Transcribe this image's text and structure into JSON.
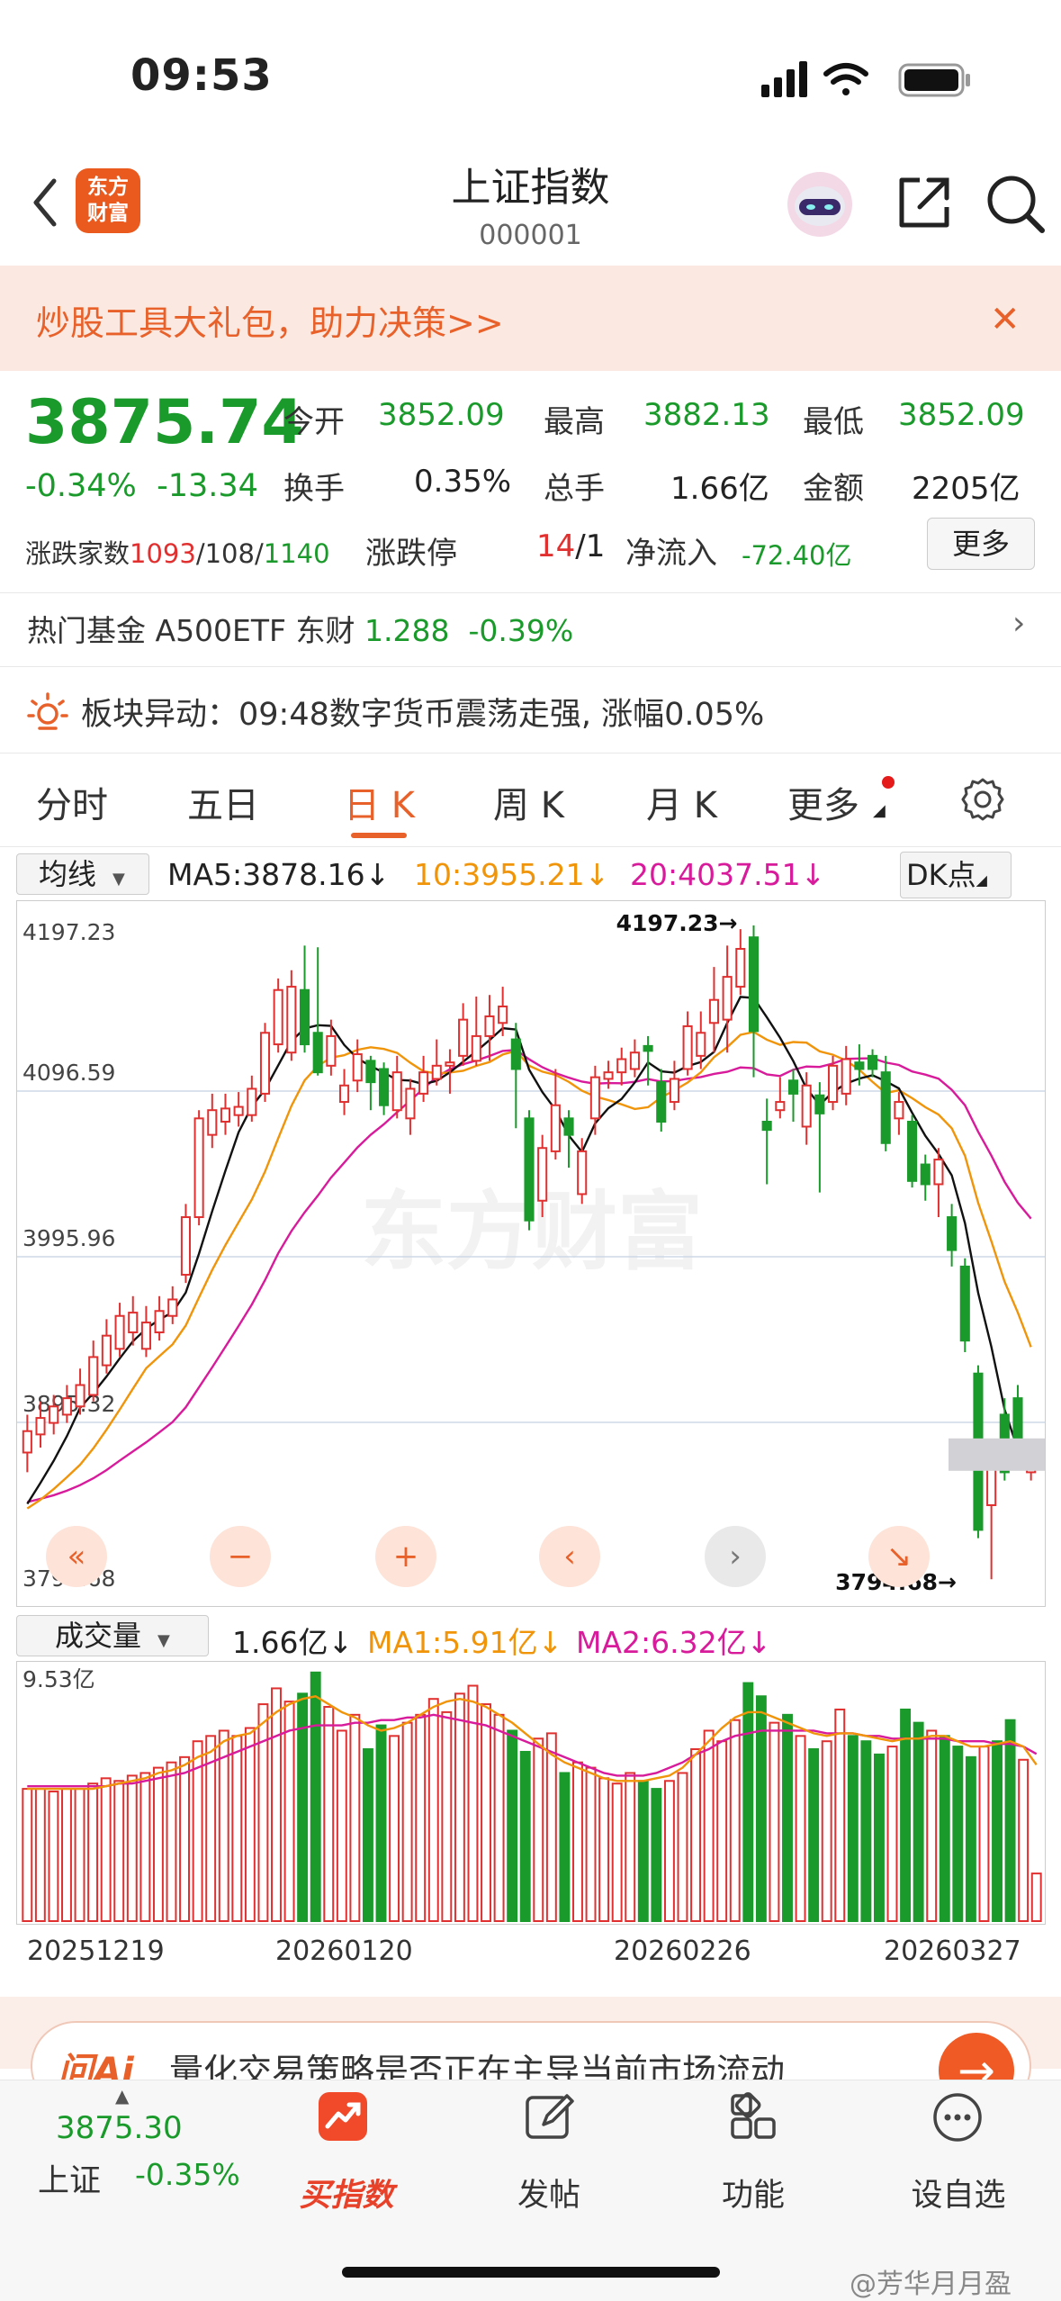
{
  "status": {
    "time": "09:53"
  },
  "header": {
    "logo": "东方财富",
    "logo_line1": "东方",
    "logo_line2": "财富",
    "title": "上证指数",
    "code": "000001"
  },
  "banner": {
    "text": "炒股工具大礼包，助力决策>>"
  },
  "quote": {
    "price": "3875.74",
    "pct": "-0.34%",
    "change": "-13.34",
    "open_label": "今开",
    "open": "3852.09",
    "high_label": "最高",
    "high": "3882.13",
    "low_label": "最低",
    "low": "3852.09",
    "turnover_label": "换手",
    "turnover": "0.35%",
    "vol_label": "总手",
    "vol": "1.66亿",
    "amount_label": "金额",
    "amount": "2205亿",
    "breadth_label": "涨跌家数",
    "up": "1093",
    "flat": "/108/",
    "down": "1140",
    "limit_label": "涨跌停",
    "limit_up": "14",
    "limit_down": "/1",
    "inflow_label": "净流入",
    "inflow": "-72.40亿",
    "more": "更多"
  },
  "fund": {
    "text": "热门基金 A500ETF 东财 ",
    "price": "1.288",
    "pct": "-0.39%"
  },
  "sector": {
    "text": "板块异动：09:48数字货币震荡走强, 涨幅0.05%"
  },
  "tabs": [
    "分时",
    "五日",
    "日 K",
    "周 K",
    "月 K",
    "更多"
  ],
  "active_tab": "日 K",
  "ma": {
    "select": "均线",
    "ma5": "MA5:3878.16",
    "ma10": "10:3955.21",
    "ma20": "20:4037.51",
    "dk": "DK点"
  },
  "vol": {
    "select": "成交量",
    "v": "1.66亿",
    "ma1": "MA1:5.91亿",
    "ma2": "MA2:6.32亿"
  },
  "colors": {
    "up": "#e03030",
    "down": "#1a9a2a",
    "ma5": "#111111",
    "ma10": "#f0940a",
    "ma20": "#d81b9b",
    "accent": "#e8612a"
  },
  "chart_data": [
    {
      "type": "candlestick",
      "title": "",
      "y_ticks": [
        "4197.23",
        "4096.59",
        "3995.96",
        "3895.32",
        "3794.68"
      ],
      "ylim": [
        3794.68,
        4197.23
      ],
      "annotations": [
        {
          "text": "4197.23",
          "value": 4197.23
        },
        {
          "text": "3794.68",
          "value": 3794.68
        }
      ],
      "x_ticks": [
        "20251219",
        "20260120",
        "20260226",
        "20260327"
      ],
      "candles": [
        {
          "o": 3877,
          "c": 3890,
          "h": 3900,
          "l": 3865
        },
        {
          "o": 3888,
          "c": 3898,
          "h": 3908,
          "l": 3880
        },
        {
          "o": 3895,
          "c": 3905,
          "h": 3912,
          "l": 3888
        },
        {
          "o": 3900,
          "c": 3910,
          "h": 3918,
          "l": 3895
        },
        {
          "o": 3905,
          "c": 3918,
          "h": 3928,
          "l": 3900
        },
        {
          "o": 3912,
          "c": 3935,
          "h": 3945,
          "l": 3908
        },
        {
          "o": 3930,
          "c": 3948,
          "h": 3958,
          "l": 3925
        },
        {
          "o": 3940,
          "c": 3960,
          "h": 3968,
          "l": 3935
        },
        {
          "o": 3950,
          "c": 3962,
          "h": 3972,
          "l": 3942
        },
        {
          "o": 3940,
          "c": 3956,
          "h": 3966,
          "l": 3935
        },
        {
          "o": 3950,
          "c": 3963,
          "h": 3972,
          "l": 3945
        },
        {
          "o": 3960,
          "c": 3970,
          "h": 3978,
          "l": 3955
        },
        {
          "o": 3985,
          "c": 4020,
          "h": 4028,
          "l": 3980
        },
        {
          "o": 4020,
          "c": 4080,
          "h": 4085,
          "l": 4015
        },
        {
          "o": 4070,
          "c": 4085,
          "h": 4095,
          "l": 4062
        },
        {
          "o": 4078,
          "c": 4086,
          "h": 4095,
          "l": 4070
        },
        {
          "o": 4082,
          "c": 4087,
          "h": 4096,
          "l": 4075
        },
        {
          "o": 4082,
          "c": 4098,
          "h": 4106,
          "l": 4078
        },
        {
          "o": 4095,
          "c": 4132,
          "h": 4138,
          "l": 4090
        },
        {
          "o": 4125,
          "c": 4158,
          "h": 4165,
          "l": 4120
        },
        {
          "o": 4120,
          "c": 4160,
          "h": 4170,
          "l": 4115
        },
        {
          "o": 4158,
          "c": 4125,
          "h": 4185,
          "l": 4120
        },
        {
          "o": 4132,
          "c": 4108,
          "h": 4184,
          "l": 4106
        },
        {
          "o": 4112,
          "c": 4130,
          "h": 4140,
          "l": 4106
        },
        {
          "o": 4090,
          "c": 4100,
          "h": 4110,
          "l": 4082
        },
        {
          "o": 4103,
          "c": 4119,
          "h": 4128,
          "l": 4096
        },
        {
          "o": 4115,
          "c": 4102,
          "h": 4118,
          "l": 4085
        },
        {
          "o": 4110,
          "c": 4088,
          "h": 4114,
          "l": 4082
        },
        {
          "o": 4085,
          "c": 4108,
          "h": 4118,
          "l": 4080
        },
        {
          "o": 4080,
          "c": 4098,
          "h": 4104,
          "l": 4070
        },
        {
          "o": 4095,
          "c": 4108,
          "h": 4118,
          "l": 4090
        },
        {
          "o": 4104,
          "c": 4112,
          "h": 4128,
          "l": 4100
        },
        {
          "o": 4112,
          "c": 4114,
          "h": 4122,
          "l": 4095
        },
        {
          "o": 4118,
          "c": 4140,
          "h": 4150,
          "l": 4112
        },
        {
          "o": 4115,
          "c": 4130,
          "h": 4154,
          "l": 4112
        },
        {
          "o": 4130,
          "c": 4142,
          "h": 4155,
          "l": 4115
        },
        {
          "o": 4138,
          "c": 4148,
          "h": 4160,
          "l": 4130
        },
        {
          "o": 4128,
          "c": 4110,
          "h": 4138,
          "l": 4074
        },
        {
          "o": 4080,
          "c": 4018,
          "h": 4085,
          "l": 4012
        },
        {
          "o": 4030,
          "c": 4062,
          "h": 4070,
          "l": 4020
        },
        {
          "o": 4060,
          "c": 4088,
          "h": 4110,
          "l": 4055
        },
        {
          "o": 4080,
          "c": 4070,
          "h": 4085,
          "l": 4050
        },
        {
          "o": 4034,
          "c": 4060,
          "h": 4068,
          "l": 4028
        },
        {
          "o": 4080,
          "c": 4105,
          "h": 4112,
          "l": 4070
        },
        {
          "o": 4104,
          "c": 4108,
          "h": 4115,
          "l": 4098
        },
        {
          "o": 4108,
          "c": 4116,
          "h": 4123,
          "l": 4100
        },
        {
          "o": 4110,
          "c": 4120,
          "h": 4128,
          "l": 4105
        },
        {
          "o": 4124,
          "c": 4121,
          "h": 4130,
          "l": 4100
        },
        {
          "o": 4102,
          "c": 4078,
          "h": 4110,
          "l": 4072
        },
        {
          "o": 4090,
          "c": 4104,
          "h": 4115,
          "l": 4085
        },
        {
          "o": 4110,
          "c": 4136,
          "h": 4145,
          "l": 4106
        },
        {
          "o": 4118,
          "c": 4132,
          "h": 4145,
          "l": 4110
        },
        {
          "o": 4138,
          "c": 4152,
          "h": 4172,
          "l": 4120
        },
        {
          "o": 4140,
          "c": 4166,
          "h": 4185,
          "l": 4120
        },
        {
          "o": 4160,
          "c": 4183,
          "h": 4195,
          "l": 4155
        },
        {
          "o": 4190,
          "c": 4133,
          "h": 4197.23,
          "l": 4105
        },
        {
          "o": 4078,
          "c": 4073,
          "h": 4092,
          "l": 4040
        },
        {
          "o": 4085,
          "c": 4090,
          "h": 4105,
          "l": 4080
        },
        {
          "o": 4103,
          "c": 4095,
          "h": 4110,
          "l": 4078
        },
        {
          "o": 4075,
          "c": 4100,
          "h": 4108,
          "l": 4064
        },
        {
          "o": 4094,
          "c": 4083,
          "h": 4102,
          "l": 4035
        },
        {
          "o": 4090,
          "c": 4112,
          "h": 4118,
          "l": 4085
        },
        {
          "o": 4095,
          "c": 4116,
          "h": 4124,
          "l": 4088
        },
        {
          "o": 4114,
          "c": 4110,
          "h": 4125,
          "l": 4100
        },
        {
          "o": 4118,
          "c": 4110,
          "h": 4122,
          "l": 4105
        },
        {
          "o": 4108,
          "c": 4065,
          "h": 4118,
          "l": 4060
        },
        {
          "o": 4080,
          "c": 4090,
          "h": 4096,
          "l": 4070
        },
        {
          "o": 4078,
          "c": 4042,
          "h": 4082,
          "l": 4038
        },
        {
          "o": 4052,
          "c": 4040,
          "h": 4058,
          "l": 4030
        },
        {
          "o": 4040,
          "c": 4055,
          "h": 4062,
          "l": 4020
        },
        {
          "o": 4020,
          "c": 4000,
          "h": 4028,
          "l": 3990
        },
        {
          "o": 3990,
          "c": 3945,
          "h": 3995,
          "l": 3938
        },
        {
          "o": 3925,
          "c": 3830,
          "h": 3930,
          "l": 3825
        },
        {
          "o": 3845,
          "c": 3876,
          "h": 3885,
          "l": 3800
        },
        {
          "o": 3900,
          "c": 3865,
          "h": 3910,
          "l": 3860
        },
        {
          "o": 3910,
          "c": 3878,
          "h": 3918,
          "l": 3875
        },
        {
          "o": 3865,
          "c": 3880,
          "h": 3883,
          "l": 3860
        }
      ]
    },
    {
      "type": "bar",
      "title": "成交量",
      "y_ticks": [
        "9.53亿"
      ],
      "ylim": [
        0,
        9.53
      ],
      "volumes": [
        5.0,
        5.0,
        4.9,
        5.0,
        5.0,
        5.2,
        5.4,
        5.3,
        5.5,
        5.6,
        5.8,
        6.0,
        6.2,
        6.8,
        7.0,
        7.2,
        7.0,
        7.3,
        8.2,
        8.8,
        8.3,
        8.6,
        9.4,
        8.1,
        7.2,
        7.8,
        6.5,
        7.4,
        7.0,
        7.5,
        7.8,
        8.4,
        7.9,
        8.6,
        8.9,
        8.2,
        7.8,
        7.2,
        6.4,
        6.9,
        7.1,
        5.6,
        6.0,
        5.8,
        5.4,
        5.2,
        5.6,
        5.3,
        5.0,
        5.3,
        5.6,
        6.5,
        7.2,
        6.8,
        7.6,
        9.0,
        8.5,
        7.5,
        7.8,
        7.0,
        6.5,
        6.8,
        8.0,
        7.0,
        6.8,
        6.3,
        6.6,
        8.0,
        7.5,
        7.2,
        7.0,
        6.6,
        6.2,
        6.6,
        6.8,
        7.6,
        6.1,
        1.8
      ],
      "ma1": [
        5.0,
        5.0,
        5.0,
        5.0,
        5.0,
        5.0,
        5.1,
        5.2,
        5.3,
        5.4,
        5.6,
        5.7,
        5.9,
        6.2,
        6.4,
        6.8,
        7.0,
        7.1,
        7.5,
        7.9,
        8.2,
        8.4,
        8.5,
        8.2,
        7.9,
        7.7,
        7.4,
        7.2,
        7.3,
        7.5,
        7.8,
        8.1,
        8.3,
        8.4,
        8.3,
        8.1,
        7.8,
        7.5,
        7.1,
        6.7,
        6.3,
        6.0,
        5.8,
        5.6,
        5.4,
        5.3,
        5.3,
        5.3,
        5.4,
        5.5,
        5.8,
        6.3,
        6.8,
        7.3,
        7.7,
        7.9,
        7.9,
        7.7,
        7.5,
        7.3,
        7.1,
        7.0,
        7.1,
        7.1,
        7.0,
        6.9,
        6.8,
        6.9,
        6.9,
        7.0,
        7.0,
        6.8,
        6.6,
        6.6,
        6.7,
        6.8,
        6.6,
        5.91
      ],
      "ma2": [
        5.1,
        5.1,
        5.1,
        5.1,
        5.1,
        5.1,
        5.1,
        5.2,
        5.2,
        5.3,
        5.4,
        5.5,
        5.6,
        5.8,
        6.0,
        6.2,
        6.4,
        6.6,
        6.8,
        7.0,
        7.2,
        7.3,
        7.4,
        7.4,
        7.4,
        7.5,
        7.5,
        7.6,
        7.6,
        7.7,
        7.7,
        7.8,
        7.7,
        7.6,
        7.5,
        7.4,
        7.2,
        7.0,
        6.8,
        6.6,
        6.4,
        6.2,
        6.0,
        5.8,
        5.6,
        5.5,
        5.5,
        5.5,
        5.6,
        5.8,
        6.0,
        6.3,
        6.5,
        6.8,
        7.0,
        7.1,
        7.2,
        7.2,
        7.2,
        7.2,
        7.2,
        7.1,
        7.1,
        7.1,
        7.0,
        7.0,
        6.9,
        6.9,
        6.9,
        6.9,
        6.9,
        6.8,
        6.8,
        6.8,
        6.7,
        6.7,
        6.6,
        6.32
      ]
    }
  ],
  "chart_tools": [
    "«",
    "−",
    "+",
    "‹",
    "›",
    "↘"
  ],
  "ai": {
    "logo": "问Ai",
    "text": "量化交易策略是否正在主导当前市场流动"
  },
  "bottom": {
    "price": "3875.30",
    "name": "上证",
    "pct": "-0.35%",
    "buy": "买指数",
    "post": "发帖",
    "func": "功能",
    "watch": "设自选"
  },
  "watermark": "@芳华月月盈"
}
